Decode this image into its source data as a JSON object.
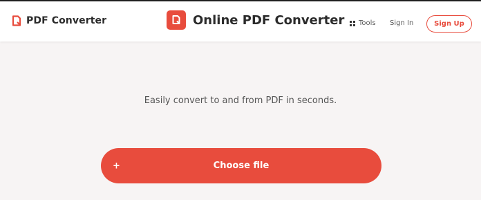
{
  "header": {
    "brand_label": "PDF Converter",
    "title": "Online PDF Converter",
    "tools_label": "Tools",
    "signin_label": "Sign In",
    "signup_label": "Sign Up"
  },
  "main": {
    "tagline": "Easily convert to and from PDF in seconds.",
    "choose_file_label": "Choose file",
    "plus_glyph": "+"
  },
  "icons": {
    "brand_logo": "pdf-logo-icon",
    "center_logo": "pdf-logo-icon",
    "tools": "grid-icon",
    "choose_file": "plus-icon"
  },
  "colors": {
    "accent": "#e84c3d",
    "background": "#f7f4f4",
    "header_bg": "#ffffff",
    "text_dark": "#2b2b2b",
    "text_muted": "#555555"
  }
}
